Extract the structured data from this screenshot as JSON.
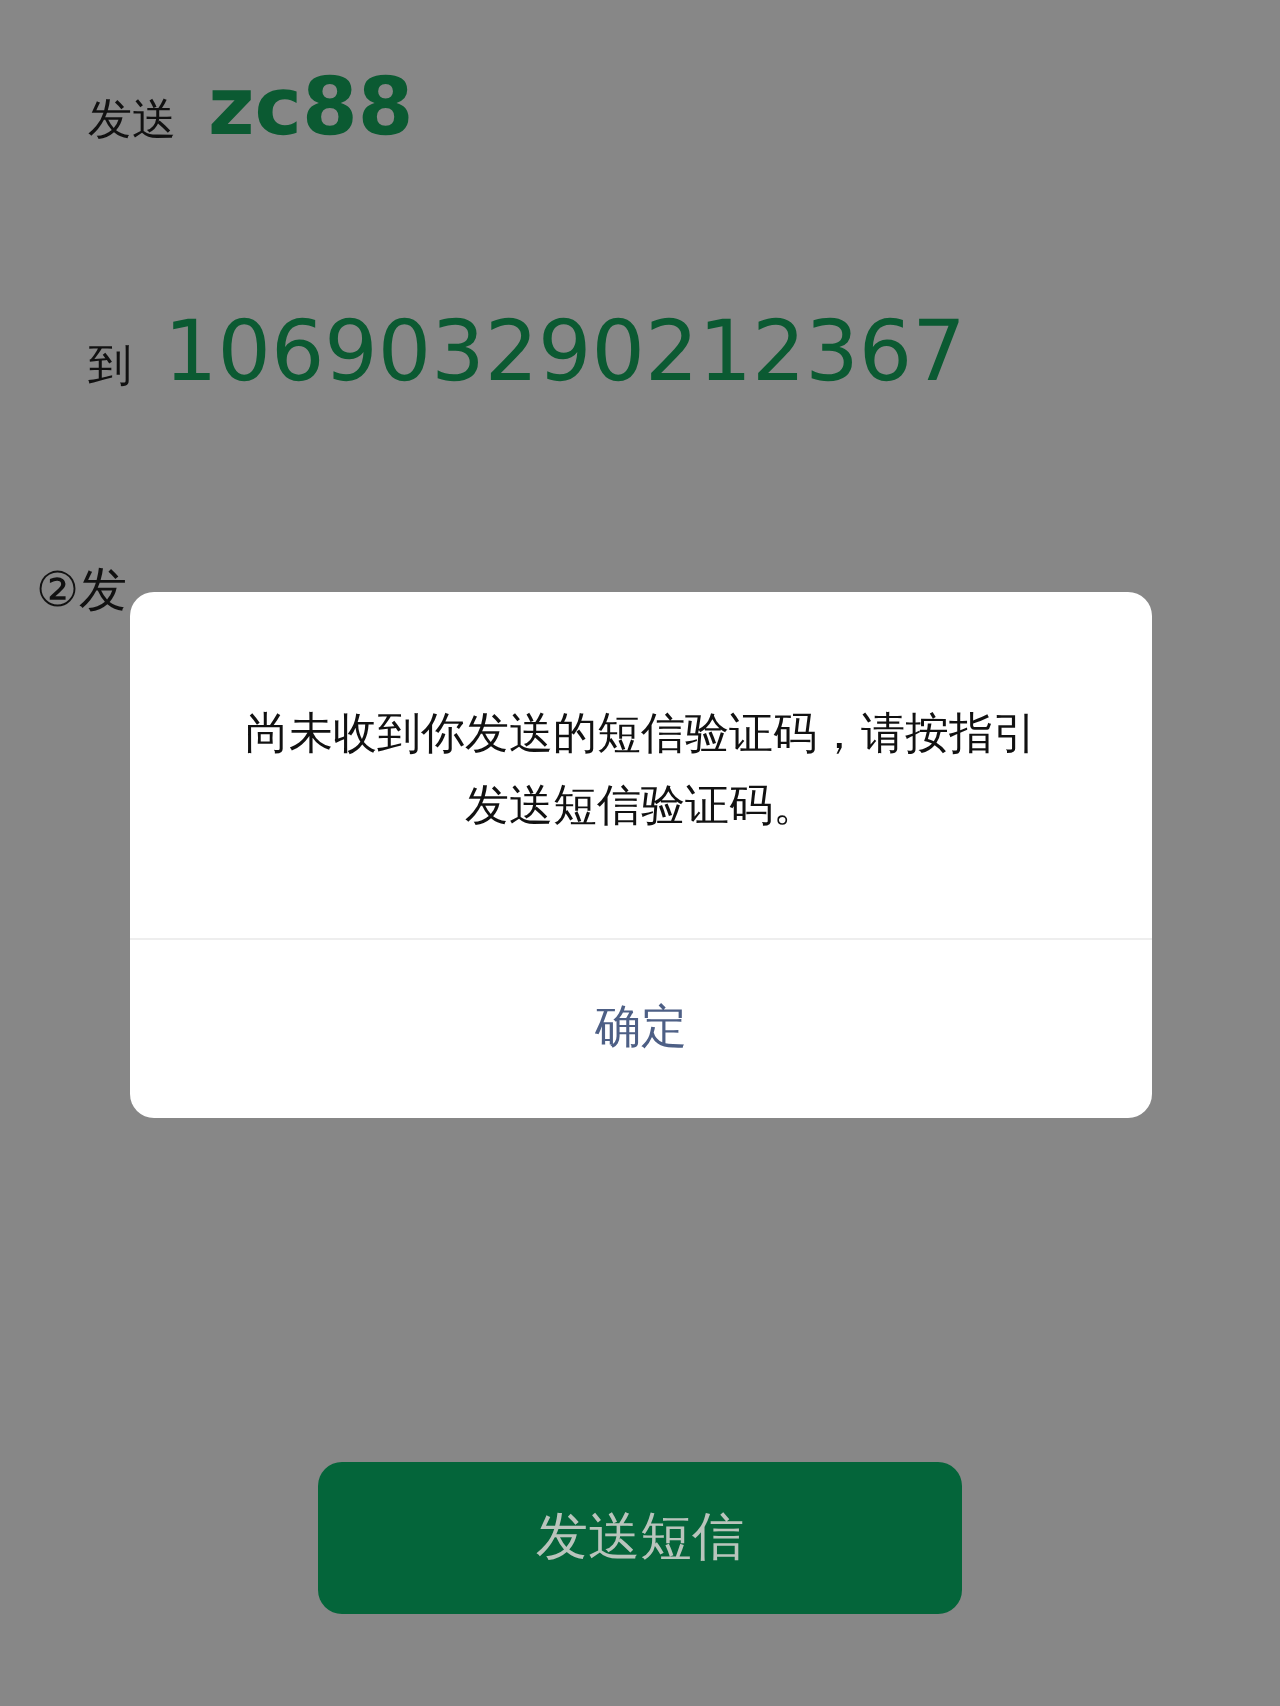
{
  "send_line": {
    "label": "发送",
    "code": "zc88"
  },
  "to_line": {
    "label": "到",
    "number": "106903290212367"
  },
  "step": {
    "text": "②发"
  },
  "dialog": {
    "message": "尚未收到你发送的短信验证码，请按指引发送短信验证码。",
    "button": "确定"
  },
  "send_button": {
    "label": "发送短信"
  }
}
